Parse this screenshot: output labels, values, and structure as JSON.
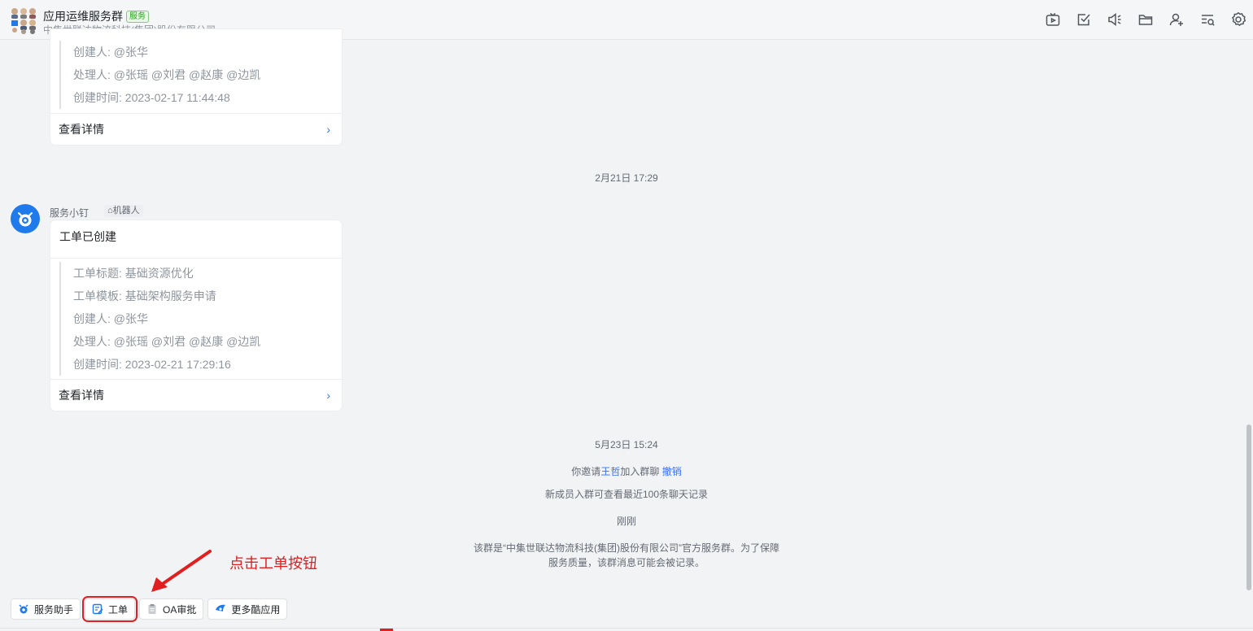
{
  "header": {
    "title": "应用运维服务群",
    "badge": "服务",
    "subtitle": "中集世联达物流科技(集团)股份有限公司",
    "icons": [
      "live-tv-icon",
      "todo-check-icon",
      "announcement-icon",
      "folder-icon",
      "add-member-icon",
      "search-history-icon",
      "settings-icon"
    ]
  },
  "card1": {
    "rows": [
      "创建人: @张华",
      "处理人: @张瑶 @刘君 @赵康 @边凯",
      "创建时间: 2023-02-17 11:44:48"
    ],
    "footer": "查看详情",
    "chevron": "›"
  },
  "timestamp1": "2月21日 17:29",
  "bot": {
    "name": "服务小钉",
    "tag": "机器人"
  },
  "card2": {
    "title": "工单已创建",
    "rows": [
      "工单标题: 基础资源优化",
      "工单模板: 基础架构服务申请",
      "创建人: @张华",
      "处理人: @张瑶 @刘君 @赵康 @边凯",
      "创建时间: 2023-02-21 17:29:16"
    ],
    "footer": "查看详情",
    "chevron": "›"
  },
  "timestamp2": "5月23日 15:24",
  "system": {
    "invite_prefix": "你邀请",
    "invite_name": "王哲",
    "invite_suffix": "加入群聊",
    "revoke": "撤销",
    "history": "新成员入群可查看最近100条聊天记录",
    "just_now": "刚刚",
    "notice_line1": "该群是“中集世联达物流科技(集团)股份有限公司”官方服务群。为了保障",
    "notice_line2": "服务质量，该群消息可能会被记录。"
  },
  "annotation": "点击工单按钮",
  "toolbar": {
    "assistant": "服务助手",
    "ticket": "工单",
    "oa": "OA审批",
    "more": "更多酷应用"
  },
  "colors": {
    "accent": "#3370ff",
    "annotation": "#e02020",
    "background": "#f2f3f5"
  }
}
